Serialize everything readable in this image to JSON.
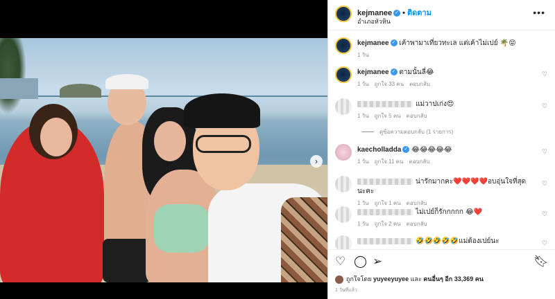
{
  "header": {
    "username": "kejmanee",
    "follow_label": "ติดตาม",
    "location": "อำเภอหัวหิน",
    "more_icon": "more-horizontal-icon"
  },
  "comments": [
    {
      "user": "kejmanee",
      "text": "เค้าพามาเที่ยวทะเล แต่เค้าไม่เปย์ 🌴😝",
      "time": "1 วัน",
      "likes": "",
      "reply": "",
      "verified": true,
      "avatar": "brand"
    },
    {
      "user": "kejmanee",
      "text": "ตามนั้นลี่😂",
      "time": "1 วัน",
      "likes": "ถูกใจ 33 คน",
      "reply": "ตอบกลับ",
      "verified": true,
      "avatar": "brand"
    },
    {
      "user": "",
      "text": "แม่วาปเก่ง😍",
      "time": "1 วัน",
      "likes": "ถูกใจ 5 คน",
      "reply": "ตอบกลับ",
      "verified": false,
      "avatar": "blurred"
    },
    {
      "user": "kaecholladda",
      "text": "😂😂😂😂😂",
      "time": "1 วัน",
      "likes": "ถูกใจ 11 คน",
      "reply": "ตอบกลับ",
      "verified": true,
      "avatar": "blurred"
    },
    {
      "user": "",
      "text": "น่ารักมากคะ❤️❤️❤️❤️อบอุ่นใจที่สุดนะคะ",
      "time": "1 วัน",
      "likes": "ถูกใจ 1 คน",
      "reply": "ตอบกลับ",
      "verified": false,
      "avatar": "blurred"
    },
    {
      "user": "",
      "text": "ไม่เปย์ก็รักกกกก 😂❤️",
      "time": "1 วัน",
      "likes": "ถูกใจ 2 คน",
      "reply": "ตอบกลับ",
      "verified": false,
      "avatar": "blurred"
    },
    {
      "user": "",
      "text": "🤣🤣🤣🤣🤣แม่ต้องเปย์นะ",
      "time": "",
      "likes": "",
      "reply": "",
      "verified": false,
      "avatar": "blurred"
    }
  ],
  "view_replies": "ดูข้อความตอบกลับ (1 รายการ)",
  "actions": {
    "like_icon": "heart-icon",
    "comment_icon": "comment-icon",
    "share_icon": "share-icon",
    "save_icon": "bookmark-icon"
  },
  "likes_summary": {
    "prefix": "ถูกใจโดย",
    "user": "yuyeeyuyee",
    "middle": "และ",
    "others": "คนอื่นๆ อีก 33,369 คน"
  },
  "post_time": "1 วันที่แล้ว"
}
